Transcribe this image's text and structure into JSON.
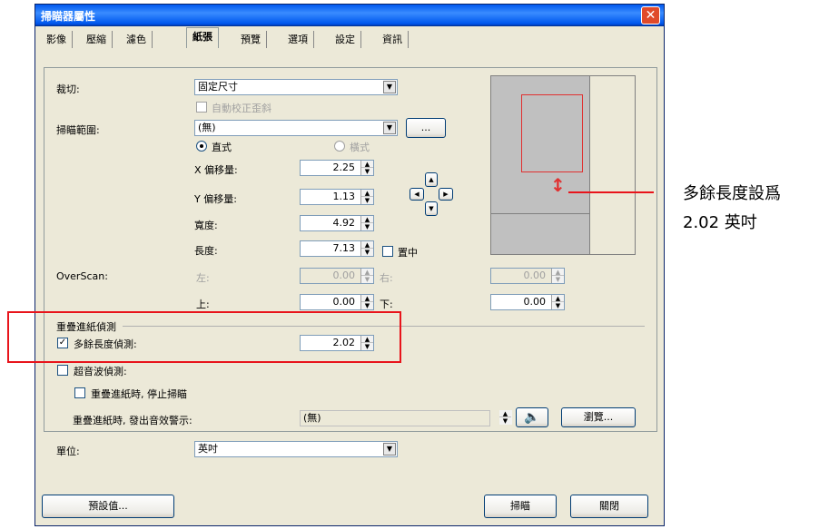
{
  "window": {
    "title": "掃瞄器屬性",
    "close_glyph": "✕"
  },
  "tabs": [
    "影像",
    "壓縮",
    "濾色",
    "紙張",
    "預覽",
    "選項",
    "設定",
    "資訊"
  ],
  "crop": {
    "label": "裁切:",
    "value": "固定尺寸",
    "auto_deskew": "自動校正歪斜"
  },
  "scan_area": {
    "label": "掃瞄範圍:",
    "value": "(無)",
    "browse_label": "...",
    "portrait": "直式",
    "landscape": "橫式"
  },
  "offsets": {
    "x_label": "X 偏移量:",
    "x_value": "2.25",
    "y_label": "Y 偏移量:",
    "y_value": "1.13",
    "width_label": "寬度:",
    "width_value": "4.92",
    "length_label": "長度:",
    "length_value": "7.13",
    "center_label": "置中"
  },
  "overscan": {
    "label": "OverScan:",
    "left_label": "左:",
    "left_value": "0.00",
    "right_label": "右:",
    "right_value": "0.00",
    "top_label": "上:",
    "top_value": "0.00",
    "bottom_label": "下:",
    "bottom_value": "0.00"
  },
  "double_feed": {
    "group_label": "重疊進紙偵測",
    "extra_length_label": "多餘長度偵測:",
    "extra_length_value": "2.02",
    "ultrasonic_label": "超音波偵測:",
    "stop_label": "重疊進紙時, 停止掃瞄",
    "sound_label": "重疊進紙時, 發出音效警示:",
    "sound_value": "(無)",
    "browse_label": "瀏覽..."
  },
  "units": {
    "label": "單位:",
    "value": "英吋"
  },
  "footer": {
    "defaults_label": "預設值...",
    "scan_label": "掃瞄",
    "close_label": "關閉"
  },
  "callout": {
    "line1": "多餘長度設爲",
    "line2": "2.02 英吋"
  },
  "colors": {
    "highlight": "#e8141b",
    "titlebar": "#0058ee"
  }
}
